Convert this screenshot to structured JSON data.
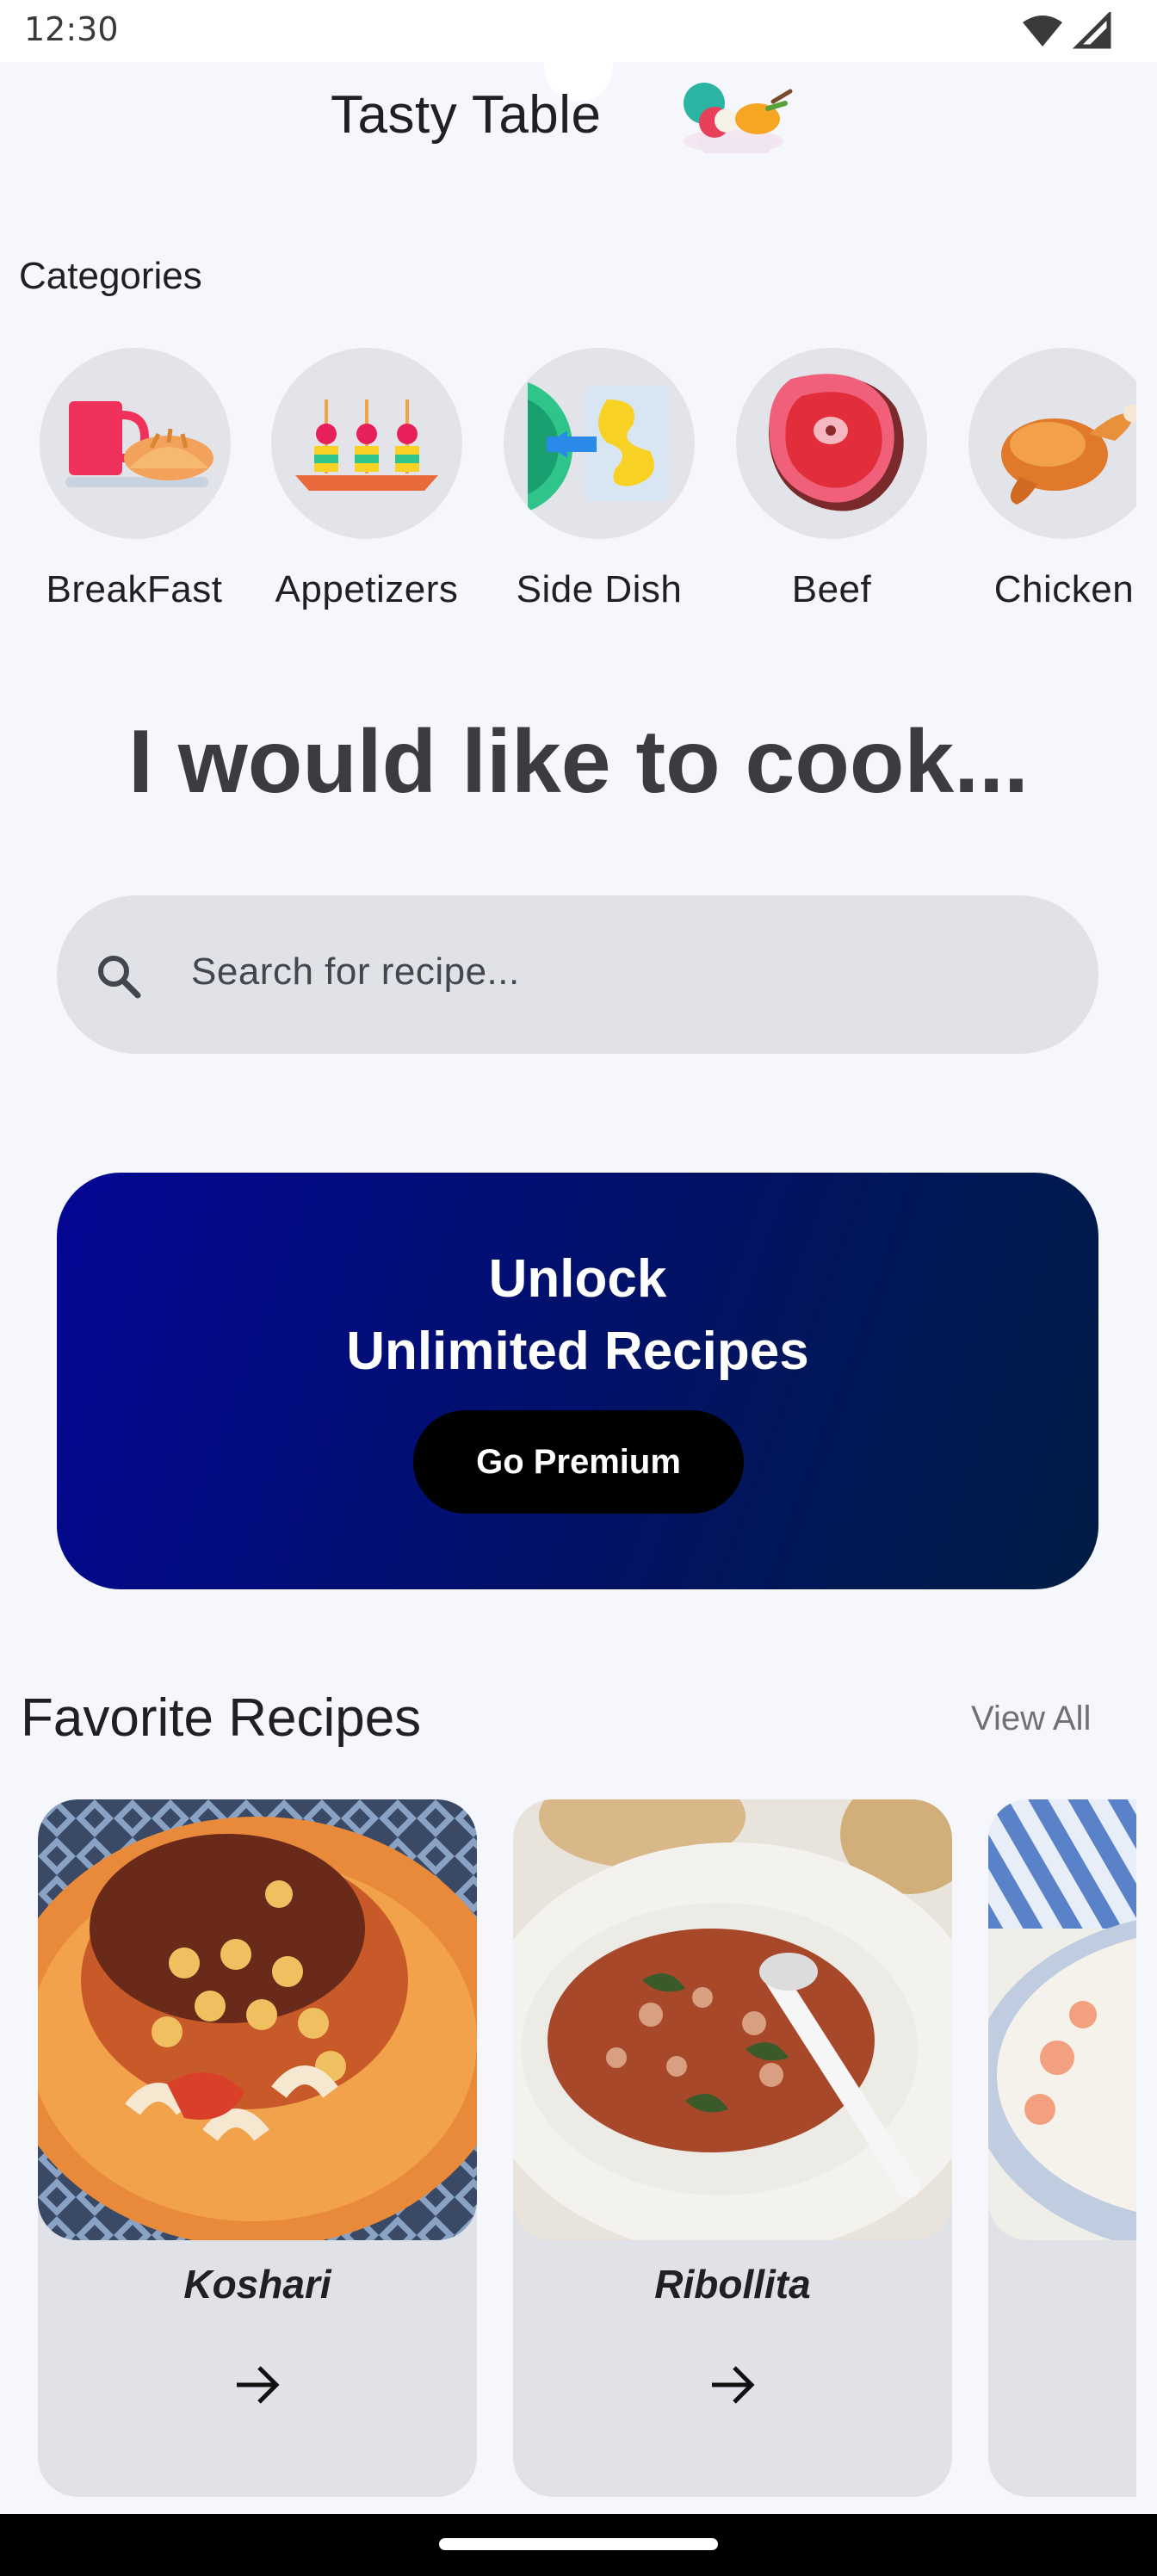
{
  "status_bar": {
    "time": "12:30"
  },
  "header": {
    "title": "Tasty Table"
  },
  "categories": {
    "label": "Categories",
    "items": [
      {
        "label": "BreakFast",
        "icon": "breakfast-icon"
      },
      {
        "label": "Appetizers",
        "icon": "appetizers-icon"
      },
      {
        "label": "Side Dish",
        "icon": "side-dish-icon"
      },
      {
        "label": "Beef",
        "icon": "beef-icon"
      },
      {
        "label": "Chicken",
        "icon": "chicken-icon"
      }
    ]
  },
  "hero": {
    "text": "I would like to cook..."
  },
  "search": {
    "placeholder": "Search for recipe..."
  },
  "premium": {
    "line1": "Unlock",
    "line2": "Unlimited Recipes",
    "button": "Go Premium"
  },
  "favorites": {
    "title": "Favorite Recipes",
    "view_all": "View All",
    "items": [
      {
        "name": "Koshari"
      },
      {
        "name": "Ribollita"
      },
      {
        "name": ""
      }
    ]
  },
  "colors": {
    "background": "#f6f7fc",
    "banner_start": "#040694",
    "banner_end": "#001d44",
    "surface": "#e1e2e7"
  }
}
